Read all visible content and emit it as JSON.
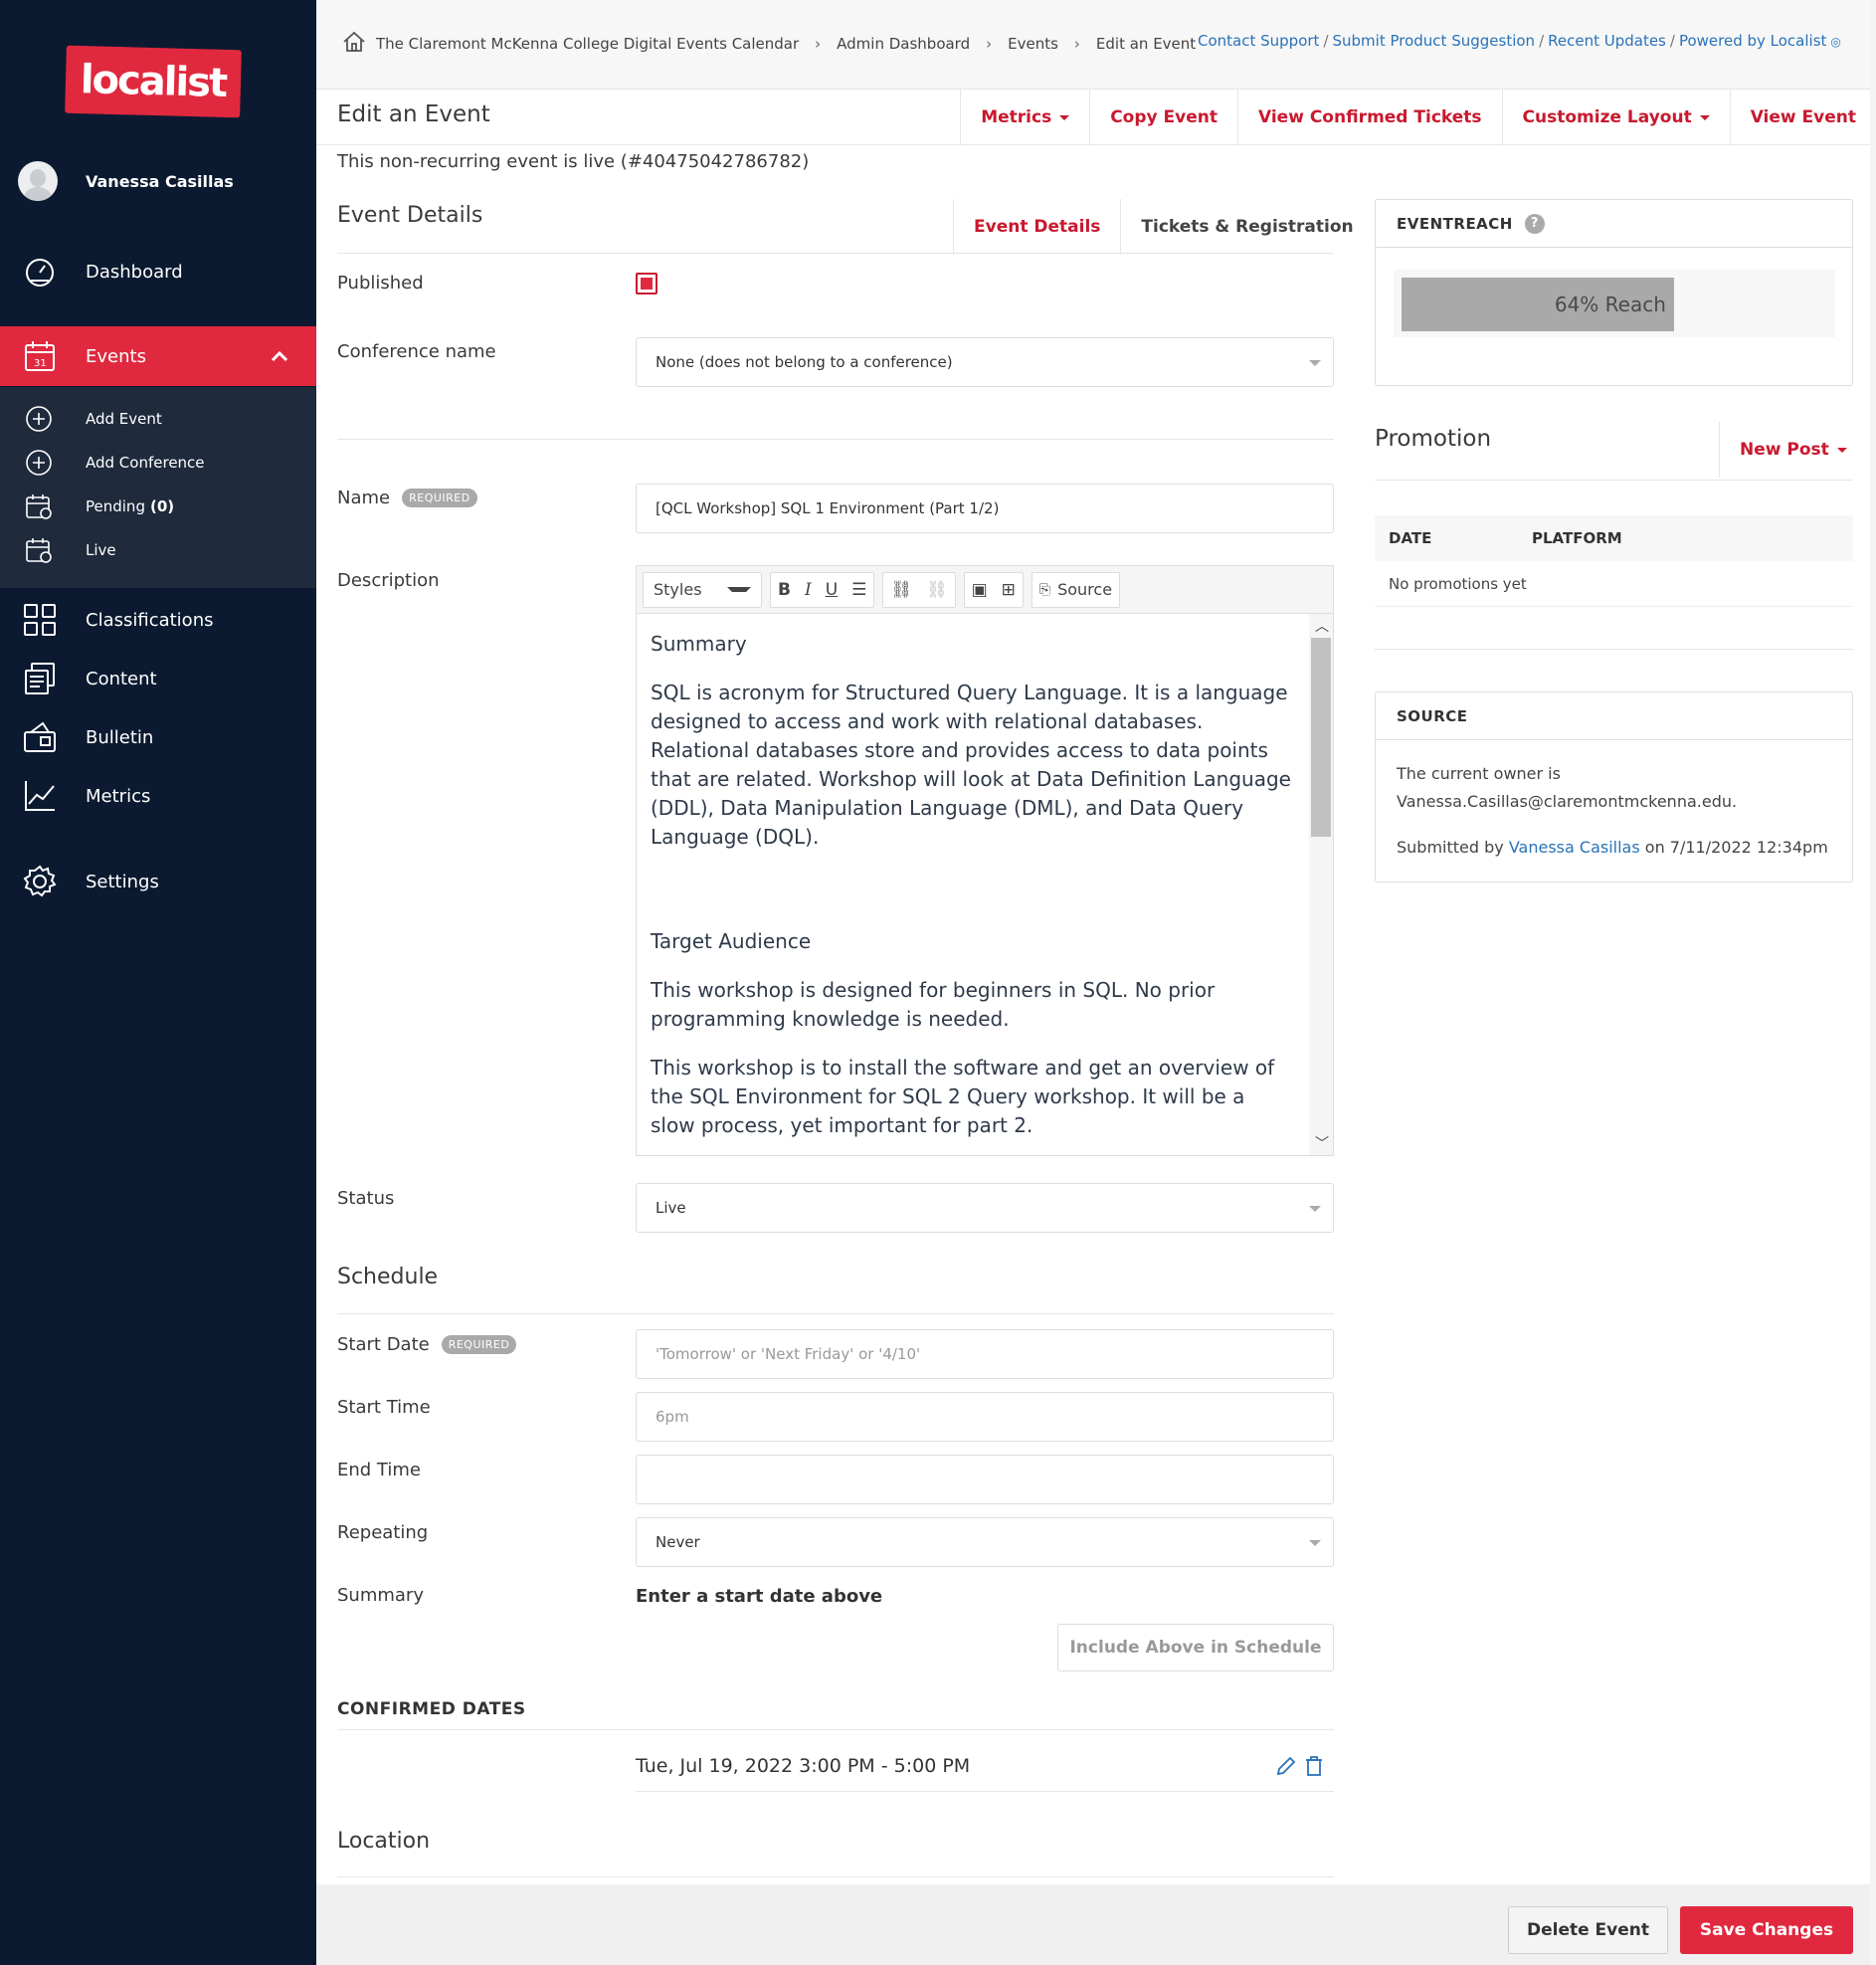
{
  "sidebar": {
    "logo": "localist",
    "user_name": "Vanessa Casillas",
    "items": [
      {
        "label": "Dashboard",
        "icon": "dashboard-icon"
      },
      {
        "label": "Events",
        "icon": "calendar-icon",
        "active": true
      },
      {
        "label": "Classifications",
        "icon": "grid-icon"
      },
      {
        "label": "Content",
        "icon": "content-icon"
      },
      {
        "label": "Bulletin",
        "icon": "bulletin-icon"
      },
      {
        "label": "Metrics",
        "icon": "chart-icon"
      },
      {
        "label": "Settings",
        "icon": "gear-icon"
      }
    ],
    "sub_items": [
      {
        "label": "Add Event",
        "icon": "plus-circle-icon"
      },
      {
        "label": "Add Conference",
        "icon": "plus-circle-icon"
      },
      {
        "label": "Pending",
        "count": "(0)",
        "icon": "calendar-pending-icon"
      },
      {
        "label": "Live",
        "icon": "calendar-live-icon"
      }
    ]
  },
  "breadcrumb": [
    "The Claremont McKenna College Digital Events Calendar",
    "Admin Dashboard",
    "Events",
    "Edit an Event"
  ],
  "top_links": [
    "Contact Support",
    "Submit Product Suggestion",
    "Recent Updates",
    "Powered by Localist"
  ],
  "header": {
    "title": "Edit an Event",
    "actions": [
      "Metrics",
      "Copy Event",
      "View Confirmed Tickets",
      "Customize Layout",
      "View Event"
    ]
  },
  "status_line": "This non-recurring event is live (#40475042786782)",
  "event_details": {
    "heading": "Event Details",
    "tabs": [
      "Event Details",
      "Tickets & Registration"
    ],
    "published_label": "Published",
    "conference_label": "Conference name",
    "conference_value": "None (does not belong to a conference)",
    "name_label": "Name",
    "required_badge": "REQUIRED",
    "name_value": "[QCL Workshop] SQL 1 Environment (Part 1/2)",
    "description_label": "Description",
    "status_label": "Status",
    "status_value": "Live"
  },
  "editor": {
    "styles_label": "Styles",
    "source_label": "Source",
    "paragraphs": [
      "Summary",
      "SQL is acronym for Structured Query Language. It is a language designed to access and work with relational databases. Relational databases store and provides access to data points that are related. Workshop will look at Data Definition Language (DDL), Data Manipulation Language (DML), and Data Query Language (DQL).",
      "Target Audience",
      "This workshop is designed for beginners in SQL. No prior programming knowledge is needed.",
      "This workshop is to install the software and get an overview of the SQL Environment for SQL 2 Query workshop. It will be a slow process, yet important for part 2."
    ]
  },
  "schedule": {
    "heading": "Schedule",
    "start_date_label": "Start Date",
    "start_date_placeholder": "'Tomorrow' or 'Next Friday' or '4/10'",
    "start_time_label": "Start Time",
    "start_time_placeholder": "6pm",
    "end_time_label": "End Time",
    "end_time_value": "",
    "repeating_label": "Repeating",
    "repeating_value": "Never",
    "summary_label": "Summary",
    "summary_value": "Enter a start date above",
    "include_button": "Include Above in Schedule",
    "confirmed_heading": "CONFIRMED DATES",
    "confirmed_dates": [
      "Tue, Jul 19, 2022 3:00 PM - 5:00 PM"
    ]
  },
  "location": {
    "heading": "Location"
  },
  "eventreach": {
    "heading": "EVENTREACH",
    "help": "?",
    "reach_percent": 64,
    "reach_label": "64% Reach"
  },
  "promotion": {
    "heading": "Promotion",
    "new_post": "New Post",
    "columns": [
      "DATE",
      "PLATFORM"
    ],
    "empty": "No promotions yet"
  },
  "source": {
    "heading": "SOURCE",
    "owner_line": "The current owner is",
    "owner_email": "Vanessa.Casillas@claremontmckenna.edu.",
    "submitted_prefix": "Submitted by",
    "submitted_by": "Vanessa Casillas",
    "submitted_suffix": "on 7/11/2022 12:34pm"
  },
  "footer": {
    "delete": "Delete Event",
    "save": "Save Changes"
  },
  "colors": {
    "accent": "#e0293f",
    "sidebar": "#0b1a30",
    "link": "#2a72b8"
  }
}
